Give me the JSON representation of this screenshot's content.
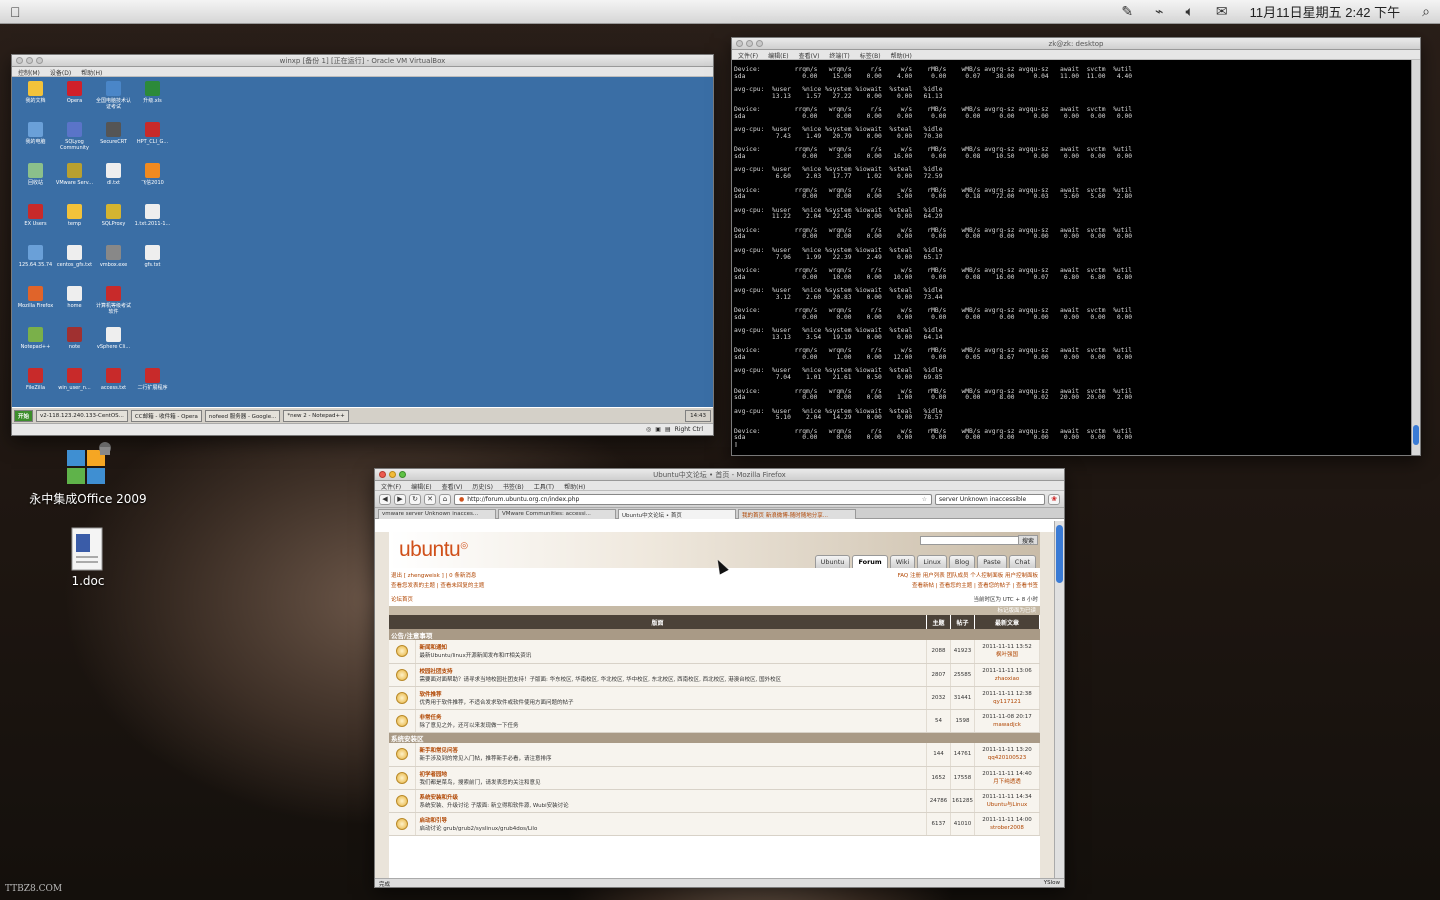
{
  "menubar": {
    "clock": "11月11日星期五 2:42 下午",
    "icons": [
      "apple-icon",
      "pen-icon",
      "network-icon",
      "volume-icon",
      "message-icon",
      "search-icon"
    ]
  },
  "vbox": {
    "title": "winxp [备份 1] [正在运行] - Oracle VM VirtualBox",
    "menus": [
      "控制(M)",
      "设备(D)",
      "帮助(H)"
    ],
    "icons": [
      {
        "label": "我的文档",
        "color": "#f2c23a"
      },
      {
        "label": "Opera",
        "color": "#d0202a"
      },
      {
        "label": "全国电脑技术认证考试",
        "color": "#4a86c8"
      },
      {
        "label": "升级.xls",
        "color": "#2c8a3a"
      },
      {
        "label": "我的电脑",
        "color": "#6aa0d8"
      },
      {
        "label": "SQLyog Community",
        "color": "#5a74c8"
      },
      {
        "label": "SecureCRT",
        "color": "#555"
      },
      {
        "label": "HPT_CLI_G...",
        "color": "#c82a2a"
      },
      {
        "label": "回收站",
        "color": "#8bc08b"
      },
      {
        "label": "VMware Serv...",
        "color": "#b8a030"
      },
      {
        "label": "dl.txt",
        "color": "#eee"
      },
      {
        "label": "飞信2010",
        "color": "#f08a20"
      },
      {
        "label": "EX Users",
        "color": "#c82a2a"
      },
      {
        "label": "temp",
        "color": "#f2c23a"
      },
      {
        "label": "SQLProxy",
        "color": "#d4b430"
      },
      {
        "label": "1.txt.2011-1...",
        "color": "#eee"
      },
      {
        "label": "125.64.35.74",
        "color": "#6aa0d8"
      },
      {
        "label": "centos_gfs.txt",
        "color": "#eee"
      },
      {
        "label": "vmbox.exe",
        "color": "#888"
      },
      {
        "label": "gfs.txt",
        "color": "#eee"
      },
      {
        "label": "Mozilla Firefox",
        "color": "#e0642a"
      },
      {
        "label": "home",
        "color": "#eee"
      },
      {
        "label": "计算机等级考试软件",
        "color": "#c82a2a"
      },
      {
        "label": "",
        "color": "transparent"
      },
      {
        "label": "Notepad++",
        "color": "#7ab04a"
      },
      {
        "label": "note",
        "color": "#a03030"
      },
      {
        "label": "vSphere Cli...",
        "color": "#eee"
      },
      {
        "label": "",
        "color": "transparent"
      },
      {
        "label": "FileZilla",
        "color": "#c82a2a"
      },
      {
        "label": "win_user_n...",
        "color": "#c82a2a"
      },
      {
        "label": "access.txt",
        "color": "#c82a2a"
      },
      {
        "label": "二行扩展程序",
        "color": "#c82a2a"
      }
    ],
    "taskbar": [
      {
        "label": "开始"
      },
      {
        "label": "v2-118.123.240.133-CentOS..."
      },
      {
        "label": "CC邮箱 - 收件箱 - Opera"
      },
      {
        "label": "nofeed 服务器 - Google..."
      },
      {
        "label": "*new 2 - Notepad++"
      }
    ],
    "tray_time": "14:43",
    "status_right": "Right Ctrl"
  },
  "terminal": {
    "title": "zk@zk: desktop",
    "menus": [
      "文件(F)",
      "编辑(E)",
      "查看(V)",
      "终端(T)",
      "标签(B)",
      "帮助(H)"
    ],
    "lines": [
      "Device:         rrqm/s   wrqm/s     r/s     w/s    rMB/s    wMB/s avgrq-sz avgqu-sz   await  svctm  %util",
      "sda               0.00    15.00    0.00    4.00     0.00     0.07    38.00     0.04   11.00  11.00   4.40",
      "",
      "avg-cpu:  %user   %nice %system %iowait  %steal   %idle",
      "          13.13    1.57   27.22    0.00    0.00   61.13",
      "",
      "Device:         rrqm/s   wrqm/s     r/s     w/s    rMB/s    wMB/s avgrq-sz avgqu-sz   await  svctm  %util",
      "sda               0.00     0.00    0.00    0.00     0.00     0.00     0.00     0.00    0.00   0.00   0.00",
      "",
      "avg-cpu:  %user   %nice %system %iowait  %steal   %idle",
      "           7.43    1.49   20.79    0.00    0.00   70.30",
      "",
      "Device:         rrqm/s   wrqm/s     r/s     w/s    rMB/s    wMB/s avgrq-sz avgqu-sz   await  svctm  %util",
      "sda               0.00     3.00    0.00   16.00     0.00     0.08    10.50     0.00    0.00   0.00   0.00",
      "",
      "avg-cpu:  %user   %nice %system %iowait  %steal   %idle",
      "           6.60    2.03   17.77    1.02    0.00   72.59",
      "",
      "Device:         rrqm/s   wrqm/s     r/s     w/s    rMB/s    wMB/s avgrq-sz avgqu-sz   await  svctm  %util",
      "sda               0.00     0.00    0.00    5.00     0.00     0.18    72.00     0.03    5.60   5.60   2.80",
      "",
      "avg-cpu:  %user   %nice %system %iowait  %steal   %idle",
      "          11.22    2.04   22.45    0.00    0.00   64.29",
      "",
      "Device:         rrqm/s   wrqm/s     r/s     w/s    rMB/s    wMB/s avgrq-sz avgqu-sz   await  svctm  %util",
      "sda               0.00     0.00    0.00    0.00     0.00     0.00     0.00     0.00    0.00   0.00   0.00",
      "",
      "avg-cpu:  %user   %nice %system %iowait  %steal   %idle",
      "           7.96    1.99   22.39    2.49    0.00   65.17",
      "",
      "Device:         rrqm/s   wrqm/s     r/s     w/s    rMB/s    wMB/s avgrq-sz avgqu-sz   await  svctm  %util",
      "sda               0.00    10.00    0.00   10.00     0.00     0.08    16.00     0.07    6.80   6.80   6.80",
      "",
      "avg-cpu:  %user   %nice %system %iowait  %steal   %idle",
      "           3.12    2.60   20.83    0.00    0.00   73.44",
      "",
      "Device:         rrqm/s   wrqm/s     r/s     w/s    rMB/s    wMB/s avgrq-sz avgqu-sz   await  svctm  %util",
      "sda               0.00     0.00    0.00    0.00     0.00     0.00     0.00     0.00    0.00   0.00   0.00",
      "",
      "avg-cpu:  %user   %nice %system %iowait  %steal   %idle",
      "          13.13    3.54   19.19    0.00    0.00   64.14",
      "",
      "Device:         rrqm/s   wrqm/s     r/s     w/s    rMB/s    wMB/s avgrq-sz avgqu-sz   await  svctm  %util",
      "sda               0.00     1.00    0.00   12.00     0.00     0.05     8.67     0.00    0.00   0.00   0.00",
      "",
      "avg-cpu:  %user   %nice %system %iowait  %steal   %idle",
      "           7.04    1.01   21.61    0.50    0.00   69.85",
      "",
      "Device:         rrqm/s   wrqm/s     r/s     w/s    rMB/s    wMB/s avgrq-sz avgqu-sz   await  svctm  %util",
      "sda               0.00     0.00    0.00    1.00     0.00     0.00     8.00     0.02   20.00  20.00   2.00",
      "",
      "avg-cpu:  %user   %nice %system %iowait  %steal   %idle",
      "           5.10    2.04   14.29    0.00    0.00   78.57",
      "",
      "Device:         rrqm/s   wrqm/s     r/s     w/s    rMB/s    wMB/s avgrq-sz avgqu-sz   await  svctm  %util",
      "sda               0.00     0.00    0.00    0.00     0.00     0.00     0.00     0.00    0.00   0.00   0.00",
      "▯"
    ]
  },
  "desktop": {
    "office_label": "永中集成Office 2009",
    "doc_label": "1.doc",
    "watermark": "TTBZ8.COM"
  },
  "firefox": {
    "title": "Ubuntu中文论坛 • 首页 - Mozilla Firefox",
    "menus": [
      "文件(F)",
      "编辑(E)",
      "查看(V)",
      "历史(S)",
      "书签(B)",
      "工具(T)",
      "帮助(H)"
    ],
    "url": "http://forum.ubuntu.org.cn/index.php",
    "search": "server Unknown inaccessible",
    "tabs": [
      "vmware server Unknown inacces...",
      "VMware Communities: accessi...",
      "Ubuntu中文论坛 • 首页",
      "我的首页 新浪微博-随时随地分享..."
    ],
    "logo": "ubuntu",
    "search_btn": "搜索",
    "navtabs": [
      "Ubuntu",
      "Forum",
      "Wiki",
      "Linux",
      "Blog",
      "Paste",
      "Chat"
    ],
    "bar1_left": "退出 [ zhengweisk ]  |  0 条新消息",
    "bar1_right": "FAQ  注册  用户列表  团队成员  个人控制面板  用户控制面板",
    "bar2_left": "查看您发表的主题 | 查看未回复的主题",
    "bar2_right": "查看新帖 | 查看您的主题 | 查看您的帖子 | 查看书签",
    "crumb": "论坛首页",
    "tz": "当前时区为 UTC + 8 小时",
    "mark_read": "标记版面为已读",
    "cols": [
      "版面",
      "主题",
      "帖子",
      "最新文章"
    ],
    "cats": [
      {
        "name": "公告/注意事项",
        "forums": [
          {
            "name": "新闻和通知",
            "desc": "最新Ubuntu/linux开源新闻发布和IT相关资讯",
            "topics": "2088",
            "posts": "41923",
            "date": "2011-11-11 13:52",
            "user": "枫叶强国"
          },
          {
            "name": "校园社团支持",
            "desc": "需要面对面帮助？请寻求当地校园社团支持！子版面: 华东校区, 华南校区, 华北校区, 华中校区, 东北校区, 西南校区, 西北校区, 港澳台校区, 国外校区",
            "topics": "2807",
            "posts": "25585",
            "date": "2011-11-11 13:06",
            "user": "zhaoxiao"
          },
          {
            "name": "软件推荐",
            "desc": "优秀用于软件推荐，不适合发求软件或软件使用方面问题的帖子",
            "topics": "2032",
            "posts": "31441",
            "date": "2011-11-11 12:38",
            "user": "qy117121"
          },
          {
            "name": "非常任务",
            "desc": "除了意见之外，还可以来发现做一下任务",
            "topics": "54",
            "posts": "1598",
            "date": "2011-11-08 20:17",
            "user": "mawadjck"
          }
        ]
      },
      {
        "name": "系统安装区",
        "forums": [
          {
            "name": "新手和常见问答",
            "desc": "新手涉及到的常见入门帖，推荐新手必看，请注意排序",
            "topics": "144",
            "posts": "14761",
            "date": "2011-11-11 13:20",
            "user": "qq420100523"
          },
          {
            "name": "初学者园地",
            "desc": "我们都是菜鸟，搜索前门，请发表您的关注和意见",
            "topics": "1652",
            "posts": "17558",
            "date": "2011-11-11 14:40",
            "user": "月下纯透透"
          },
          {
            "name": "系统安装和升级",
            "desc": "系统安装、升级讨论 子版面: 新立得和软件源, Wubi安装讨论",
            "topics": "24786",
            "posts": "161285",
            "date": "2011-11-11 14:34",
            "user": "Ubuntu与Linux"
          },
          {
            "name": "启动和引导",
            "desc": "启动讨论 grub/grub2/syslinux/grub4dos/Lilo",
            "topics": "6137",
            "posts": "41010",
            "date": "2011-11-11 14:00",
            "user": "strober2008"
          }
        ]
      }
    ],
    "status_left": "完成",
    "status_right": "YSlow"
  }
}
